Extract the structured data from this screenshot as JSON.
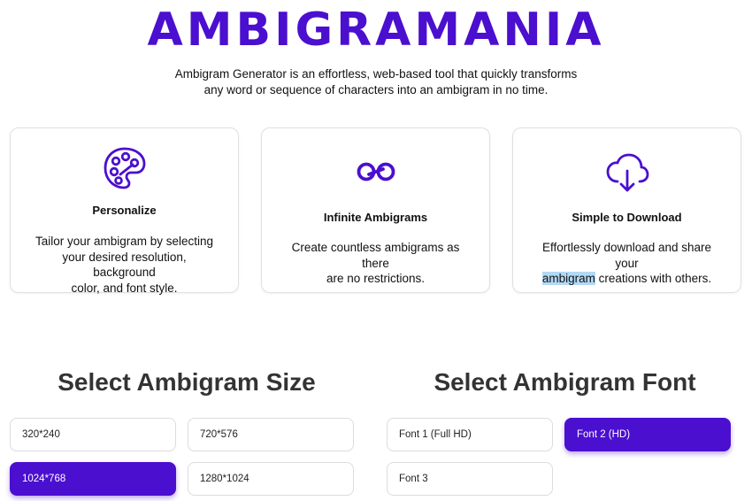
{
  "brand": {
    "logo_text": "AMBIGRAMANIA",
    "accent_color": "#4b0fcf"
  },
  "tagline": {
    "line1": "Ambigram Generator is an effortless, web-based tool that quickly transforms",
    "line2": "any word or sequence of characters into an ambigram in no time."
  },
  "features": [
    {
      "icon": "palette-icon",
      "title": "Personalize",
      "description_lines": [
        "Tailor your ambigram by selecting",
        "your desired resolution, background",
        "color, and font style."
      ]
    },
    {
      "icon": "infinity-icon",
      "title": "Infinite Ambigrams",
      "description_lines": [
        "Create countless ambigrams as there",
        "are no restrictions."
      ]
    },
    {
      "icon": "cloud-download-icon",
      "title": "Simple to Download",
      "description_line1": "Effortlessly download and share your",
      "description_line2_highlight": "ambigram",
      "description_line2_rest": " creations with others."
    }
  ],
  "size_section": {
    "title": "Select Ambigram Size",
    "options": [
      "320*240",
      "720*576",
      "1024*768",
      "1280*1024"
    ],
    "selected": "1024*768"
  },
  "font_section": {
    "title": "Select Ambigram Font",
    "options": [
      "Font 1 (Full HD)",
      "Font 2 (HD)",
      "Font 3"
    ],
    "selected": "Font 2 (HD)"
  }
}
